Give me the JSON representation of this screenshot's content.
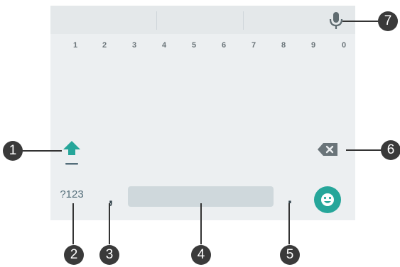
{
  "keyboard": {
    "number_row": [
      "1",
      "2",
      "3",
      "4",
      "5",
      "6",
      "7",
      "8",
      "9",
      "0"
    ],
    "symbols_key_label": "?123",
    "comma_label": ",",
    "period_label": ".",
    "accent_color": "#26a69a"
  },
  "icons": {
    "mic": "microphone-icon",
    "shift": "shift-arrow-icon",
    "backspace": "backspace-icon",
    "emoji": "smiley-icon"
  },
  "callouts": [
    "1",
    "2",
    "3",
    "4",
    "5",
    "6",
    "7"
  ]
}
